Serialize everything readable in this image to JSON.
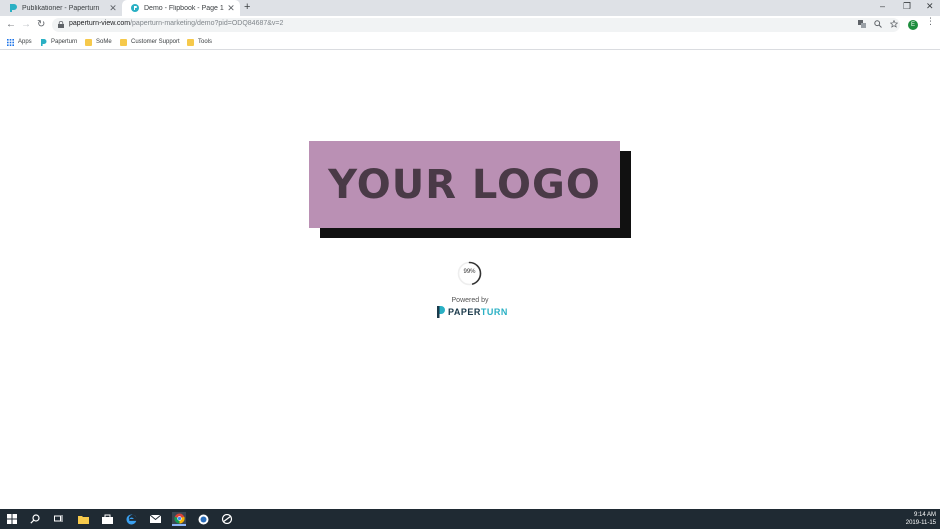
{
  "browser": {
    "tabs": [
      {
        "title": "Publikationer - Paperturn",
        "favicon": "paperturn-icon"
      },
      {
        "title": "Demo - Flipbook - Page 1",
        "favicon": "page-loading-icon"
      }
    ],
    "url_host": "paperturn-view.com",
    "url_path": "/paperturn-marketing/demo?pid=ODQ84687&v=2",
    "profile_initial": "E",
    "bookmarks": [
      {
        "label": "Apps",
        "icon": "apps-grid-icon"
      },
      {
        "label": "Paperturn",
        "icon": "paperturn-icon"
      },
      {
        "label": "SoMe",
        "icon": "folder-icon"
      },
      {
        "label": "Customer Support",
        "icon": "folder-icon"
      },
      {
        "label": "Tools",
        "icon": "folder-icon"
      }
    ]
  },
  "page": {
    "logo_text": "YOUR LOGO",
    "loading_percent": "99%",
    "loading_progress": 0.99,
    "powered_by": "Powered by",
    "brand_part1": "PAPER",
    "brand_part2": "TURN"
  },
  "taskbar": {
    "time": "9:14 AM",
    "date": "2019-11-15"
  },
  "colors": {
    "logo_bg": "#ba90b4",
    "logo_text": "#4a3a47",
    "brand_dark": "#1b3a4b",
    "brand_teal": "#2ab0c4"
  }
}
